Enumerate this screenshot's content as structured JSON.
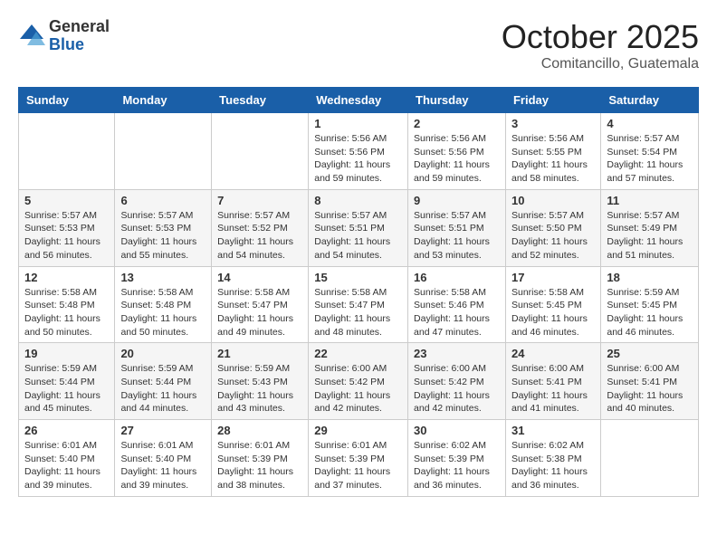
{
  "logo": {
    "general": "General",
    "blue": "Blue"
  },
  "title": "October 2025",
  "location": "Comitancillo, Guatemala",
  "days_header": [
    "Sunday",
    "Monday",
    "Tuesday",
    "Wednesday",
    "Thursday",
    "Friday",
    "Saturday"
  ],
  "weeks": [
    [
      {
        "day": "",
        "info": ""
      },
      {
        "day": "",
        "info": ""
      },
      {
        "day": "",
        "info": ""
      },
      {
        "day": "1",
        "info": "Sunrise: 5:56 AM\nSunset: 5:56 PM\nDaylight: 11 hours\nand 59 minutes."
      },
      {
        "day": "2",
        "info": "Sunrise: 5:56 AM\nSunset: 5:56 PM\nDaylight: 11 hours\nand 59 minutes."
      },
      {
        "day": "3",
        "info": "Sunrise: 5:56 AM\nSunset: 5:55 PM\nDaylight: 11 hours\nand 58 minutes."
      },
      {
        "day": "4",
        "info": "Sunrise: 5:57 AM\nSunset: 5:54 PM\nDaylight: 11 hours\nand 57 minutes."
      }
    ],
    [
      {
        "day": "5",
        "info": "Sunrise: 5:57 AM\nSunset: 5:53 PM\nDaylight: 11 hours\nand 56 minutes."
      },
      {
        "day": "6",
        "info": "Sunrise: 5:57 AM\nSunset: 5:53 PM\nDaylight: 11 hours\nand 55 minutes."
      },
      {
        "day": "7",
        "info": "Sunrise: 5:57 AM\nSunset: 5:52 PM\nDaylight: 11 hours\nand 54 minutes."
      },
      {
        "day": "8",
        "info": "Sunrise: 5:57 AM\nSunset: 5:51 PM\nDaylight: 11 hours\nand 54 minutes."
      },
      {
        "day": "9",
        "info": "Sunrise: 5:57 AM\nSunset: 5:51 PM\nDaylight: 11 hours\nand 53 minutes."
      },
      {
        "day": "10",
        "info": "Sunrise: 5:57 AM\nSunset: 5:50 PM\nDaylight: 11 hours\nand 52 minutes."
      },
      {
        "day": "11",
        "info": "Sunrise: 5:57 AM\nSunset: 5:49 PM\nDaylight: 11 hours\nand 51 minutes."
      }
    ],
    [
      {
        "day": "12",
        "info": "Sunrise: 5:58 AM\nSunset: 5:48 PM\nDaylight: 11 hours\nand 50 minutes."
      },
      {
        "day": "13",
        "info": "Sunrise: 5:58 AM\nSunset: 5:48 PM\nDaylight: 11 hours\nand 50 minutes."
      },
      {
        "day": "14",
        "info": "Sunrise: 5:58 AM\nSunset: 5:47 PM\nDaylight: 11 hours\nand 49 minutes."
      },
      {
        "day": "15",
        "info": "Sunrise: 5:58 AM\nSunset: 5:47 PM\nDaylight: 11 hours\nand 48 minutes."
      },
      {
        "day": "16",
        "info": "Sunrise: 5:58 AM\nSunset: 5:46 PM\nDaylight: 11 hours\nand 47 minutes."
      },
      {
        "day": "17",
        "info": "Sunrise: 5:58 AM\nSunset: 5:45 PM\nDaylight: 11 hours\nand 46 minutes."
      },
      {
        "day": "18",
        "info": "Sunrise: 5:59 AM\nSunset: 5:45 PM\nDaylight: 11 hours\nand 46 minutes."
      }
    ],
    [
      {
        "day": "19",
        "info": "Sunrise: 5:59 AM\nSunset: 5:44 PM\nDaylight: 11 hours\nand 45 minutes."
      },
      {
        "day": "20",
        "info": "Sunrise: 5:59 AM\nSunset: 5:44 PM\nDaylight: 11 hours\nand 44 minutes."
      },
      {
        "day": "21",
        "info": "Sunrise: 5:59 AM\nSunset: 5:43 PM\nDaylight: 11 hours\nand 43 minutes."
      },
      {
        "day": "22",
        "info": "Sunrise: 6:00 AM\nSunset: 5:42 PM\nDaylight: 11 hours\nand 42 minutes."
      },
      {
        "day": "23",
        "info": "Sunrise: 6:00 AM\nSunset: 5:42 PM\nDaylight: 11 hours\nand 42 minutes."
      },
      {
        "day": "24",
        "info": "Sunrise: 6:00 AM\nSunset: 5:41 PM\nDaylight: 11 hours\nand 41 minutes."
      },
      {
        "day": "25",
        "info": "Sunrise: 6:00 AM\nSunset: 5:41 PM\nDaylight: 11 hours\nand 40 minutes."
      }
    ],
    [
      {
        "day": "26",
        "info": "Sunrise: 6:01 AM\nSunset: 5:40 PM\nDaylight: 11 hours\nand 39 minutes."
      },
      {
        "day": "27",
        "info": "Sunrise: 6:01 AM\nSunset: 5:40 PM\nDaylight: 11 hours\nand 39 minutes."
      },
      {
        "day": "28",
        "info": "Sunrise: 6:01 AM\nSunset: 5:39 PM\nDaylight: 11 hours\nand 38 minutes."
      },
      {
        "day": "29",
        "info": "Sunrise: 6:01 AM\nSunset: 5:39 PM\nDaylight: 11 hours\nand 37 minutes."
      },
      {
        "day": "30",
        "info": "Sunrise: 6:02 AM\nSunset: 5:39 PM\nDaylight: 11 hours\nand 36 minutes."
      },
      {
        "day": "31",
        "info": "Sunrise: 6:02 AM\nSunset: 5:38 PM\nDaylight: 11 hours\nand 36 minutes."
      },
      {
        "day": "",
        "info": ""
      }
    ]
  ]
}
